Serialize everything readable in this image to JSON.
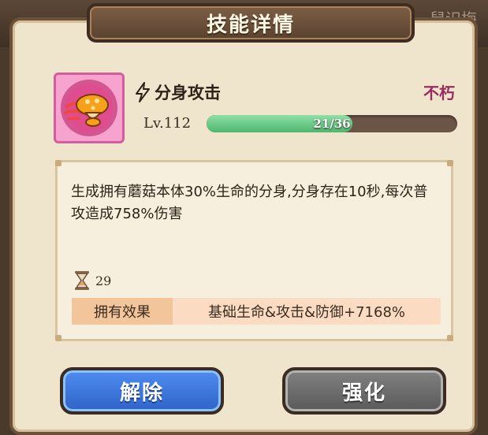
{
  "background": {
    "ghost_text": "鼠识梅"
  },
  "dialog": {
    "title": "技能详情"
  },
  "skill": {
    "icon": "mushroom-icon",
    "type_icon": "lightning-bolt-icon",
    "name": "分身攻击",
    "tier": "不朽",
    "level_label": "Lv.112",
    "progress_text": "21/36",
    "progress_fraction": 0.583
  },
  "description": {
    "text": "生成拥有蘑菇本体30%生命的分身,分身存在10秒,每次普攻造成758%伤害",
    "duration_icon": "hourglass-icon",
    "duration_value": "29",
    "effect_label": "拥有效果",
    "effect_value": "基础生命&攻击&防御+7168%"
  },
  "buttons": {
    "left_label": "解除",
    "right_label": "强化"
  },
  "colors": {
    "tier": "#9b2a5e",
    "progress_fill": "#4fb66f",
    "primary_button": "#2f63c8",
    "secondary_button": "#5a5a5a"
  }
}
